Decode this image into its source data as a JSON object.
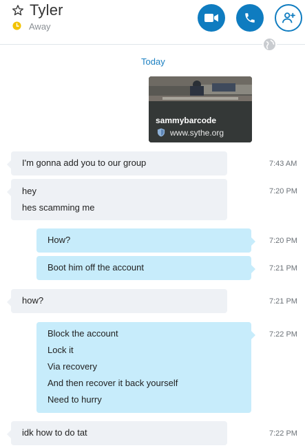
{
  "header": {
    "contact_name": "Tyler",
    "status": "Away",
    "icons": [
      "star-icon",
      "clock-icon",
      "video-call-icon",
      "audio-call-icon",
      "add-people-icon",
      "globe-icon"
    ],
    "accent_color": "#0f7cc0",
    "status_color": "#f2c200"
  },
  "conversation": {
    "date_divider": "Today",
    "link_preview": {
      "title": "sammybarcode",
      "url": "www.sythe.org"
    },
    "messages": [
      {
        "direction": "incoming",
        "lines": [
          "I'm gonna add you to our group"
        ],
        "time": "7:43 AM"
      },
      {
        "direction": "incoming",
        "lines": [
          "hey",
          "hes scamming me"
        ],
        "time": "7:20 PM"
      },
      {
        "direction": "outgoing",
        "lines": [
          "How?"
        ],
        "time": "7:20 PM"
      },
      {
        "direction": "outgoing",
        "lines": [
          "Boot him off the account"
        ],
        "time": "7:21 PM"
      },
      {
        "direction": "incoming",
        "lines": [
          "how?"
        ],
        "time": "7:21 PM"
      },
      {
        "direction": "outgoing",
        "lines": [
          "Block the account",
          "Lock it",
          "Via recovery",
          "And then recover it back yourself",
          "Need to hurry"
        ],
        "time": "7:22 PM"
      },
      {
        "direction": "incoming",
        "lines": [
          "idk how to do tat"
        ],
        "time": "7:22 PM"
      }
    ],
    "incoming_bubble_color": "#eef1f5",
    "outgoing_bubble_color": "#c7ecfb"
  }
}
